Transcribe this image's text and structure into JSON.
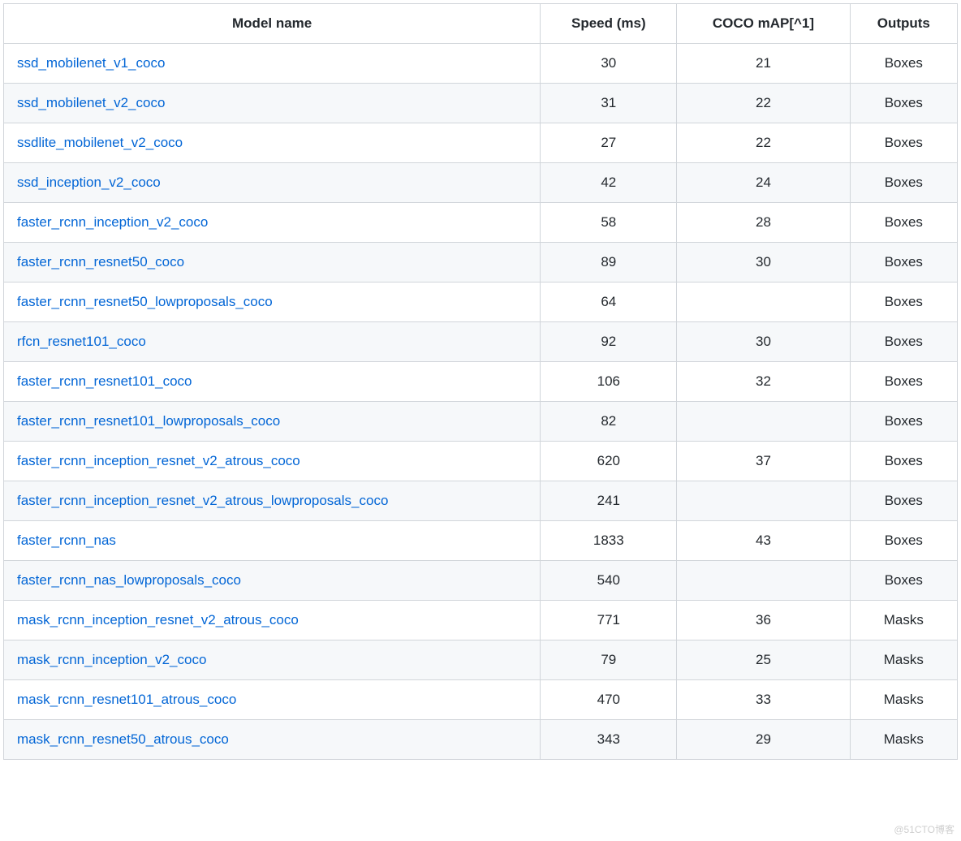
{
  "table": {
    "headers": {
      "model": "Model name",
      "speed": "Speed (ms)",
      "map": "COCO mAP[^1]",
      "outputs": "Outputs"
    },
    "rows": [
      {
        "model": "ssd_mobilenet_v1_coco",
        "speed": "30",
        "map": "21",
        "outputs": "Boxes"
      },
      {
        "model": "ssd_mobilenet_v2_coco",
        "speed": "31",
        "map": "22",
        "outputs": "Boxes"
      },
      {
        "model": "ssdlite_mobilenet_v2_coco",
        "speed": "27",
        "map": "22",
        "outputs": "Boxes"
      },
      {
        "model": "ssd_inception_v2_coco",
        "speed": "42",
        "map": "24",
        "outputs": "Boxes"
      },
      {
        "model": "faster_rcnn_inception_v2_coco",
        "speed": "58",
        "map": "28",
        "outputs": "Boxes"
      },
      {
        "model": "faster_rcnn_resnet50_coco",
        "speed": "89",
        "map": "30",
        "outputs": "Boxes"
      },
      {
        "model": "faster_rcnn_resnet50_lowproposals_coco",
        "speed": "64",
        "map": "",
        "outputs": "Boxes"
      },
      {
        "model": "rfcn_resnet101_coco",
        "speed": "92",
        "map": "30",
        "outputs": "Boxes"
      },
      {
        "model": "faster_rcnn_resnet101_coco",
        "speed": "106",
        "map": "32",
        "outputs": "Boxes"
      },
      {
        "model": "faster_rcnn_resnet101_lowproposals_coco",
        "speed": "82",
        "map": "",
        "outputs": "Boxes"
      },
      {
        "model": "faster_rcnn_inception_resnet_v2_atrous_coco",
        "speed": "620",
        "map": "37",
        "outputs": "Boxes"
      },
      {
        "model": "faster_rcnn_inception_resnet_v2_atrous_lowproposals_coco",
        "speed": "241",
        "map": "",
        "outputs": "Boxes"
      },
      {
        "model": "faster_rcnn_nas",
        "speed": "1833",
        "map": "43",
        "outputs": "Boxes"
      },
      {
        "model": "faster_rcnn_nas_lowproposals_coco",
        "speed": "540",
        "map": "",
        "outputs": "Boxes"
      },
      {
        "model": "mask_rcnn_inception_resnet_v2_atrous_coco",
        "speed": "771",
        "map": "36",
        "outputs": "Masks"
      },
      {
        "model": "mask_rcnn_inception_v2_coco",
        "speed": "79",
        "map": "25",
        "outputs": "Masks"
      },
      {
        "model": "mask_rcnn_resnet101_atrous_coco",
        "speed": "470",
        "map": "33",
        "outputs": "Masks"
      },
      {
        "model": "mask_rcnn_resnet50_atrous_coco",
        "speed": "343",
        "map": "29",
        "outputs": "Masks"
      }
    ]
  },
  "watermark": "@51CTO博客"
}
